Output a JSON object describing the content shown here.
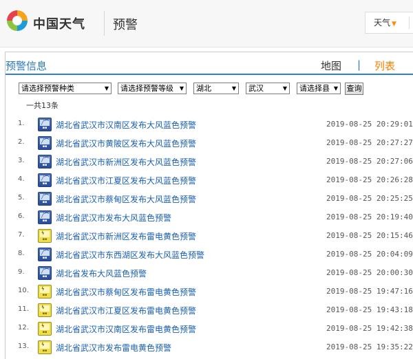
{
  "header": {
    "brand": "中国天气",
    "section": "预警",
    "weather_dropdown": {
      "label": "天气"
    }
  },
  "panel": {
    "title": "预警信息",
    "view_map": "地图",
    "separator": "|",
    "view_list": "列表"
  },
  "filters": {
    "type": "请选择预警种类",
    "level": "请选择预警等级",
    "province": "湖北",
    "city": "武汉",
    "county": "请选择县",
    "search_label": "查询"
  },
  "total_text": "一共13条",
  "alerts": [
    {
      "num": "1.",
      "title": "湖北省武汉市汉南区发布大风蓝色预警",
      "time": "2019-08-25 20:29:01",
      "kind": "wind",
      "color": "blue"
    },
    {
      "num": "2.",
      "title": "湖北省武汉市黄陂区发布大风蓝色预警",
      "time": "2019-08-25 20:27:27",
      "kind": "wind",
      "color": "blue"
    },
    {
      "num": "3.",
      "title": "湖北省武汉市新洲区发布大风蓝色预警",
      "time": "2019-08-25 20:27:06",
      "kind": "wind",
      "color": "blue"
    },
    {
      "num": "4.",
      "title": "湖北省武汉市江夏区发布大风蓝色预警",
      "time": "2019-08-25 20:26:28",
      "kind": "wind",
      "color": "blue"
    },
    {
      "num": "5.",
      "title": "湖北省武汉市蔡甸区发布大风蓝色预警",
      "time": "2019-08-25 20:25:25",
      "kind": "wind",
      "color": "blue"
    },
    {
      "num": "6.",
      "title": "湖北省武汉市发布大风蓝色预警",
      "time": "2019-08-25 20:19:40",
      "kind": "wind",
      "color": "blue"
    },
    {
      "num": "7.",
      "title": "湖北省武汉市新洲区发布雷电黄色预警",
      "time": "2019-08-25 20:15:46",
      "kind": "thunder",
      "color": "yellow"
    },
    {
      "num": "8.",
      "title": "湖北省武汉市东西湖区发布大风蓝色预警",
      "time": "2019-08-25 20:04:09",
      "kind": "wind",
      "color": "blue"
    },
    {
      "num": "9.",
      "title": "湖北省发布大风蓝色预警",
      "time": "2019-08-25 20:00:30",
      "kind": "wind",
      "color": "blue"
    },
    {
      "num": "10.",
      "title": "湖北省武汉市蔡甸区发布雷电黄色预警",
      "time": "2019-08-25 19:47:16",
      "kind": "thunder",
      "color": "yellow"
    },
    {
      "num": "11.",
      "title": "湖北省武汉市江夏区发布雷电黄色预警",
      "time": "2019-08-25 19:43:18",
      "kind": "thunder",
      "color": "yellow"
    },
    {
      "num": "12.",
      "title": "湖北省武汉市汉南区发布雷电黄色预警",
      "time": "2019-08-25 19:42:38",
      "kind": "thunder",
      "color": "yellow"
    },
    {
      "num": "13.",
      "title": "湖北省武汉市发布雷电黄色预警",
      "time": "2019-08-25 19:35:22",
      "kind": "thunder",
      "color": "yellow"
    }
  ],
  "colors": {
    "accent": "#2d7fd3",
    "active_tab": "#ff7f00",
    "link": "#1a5fb4",
    "blue_alert": "#2a4e9a",
    "yellow_alert": "#f0dd4a"
  }
}
